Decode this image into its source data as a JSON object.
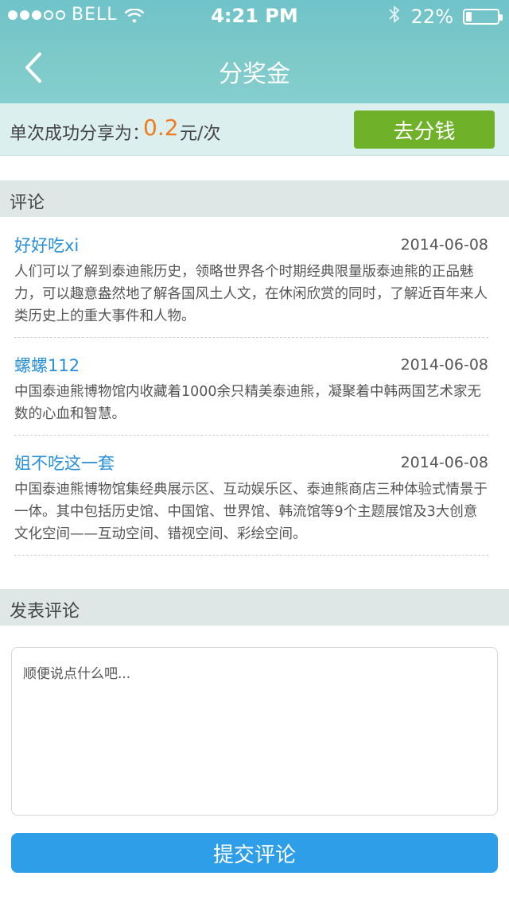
{
  "status_bar": {
    "carrier": "BELL",
    "time": "4:21 PM",
    "battery_text": "22%",
    "battery_level": 0.22,
    "signal_bars_filled": 3,
    "signal_bars_total": 5
  },
  "nav": {
    "title": "分奖金",
    "back_icon": "chevron-left-icon"
  },
  "share": {
    "label": "单次成功分享为：",
    "amount": "0.2",
    "unit": "元/次",
    "button": "去分钱",
    "button_color": "#6fb229",
    "amount_color": "#f07b1e"
  },
  "comments_section": {
    "title": "评论",
    "items": [
      {
        "user": "好好吃xi",
        "date": "2014-06-08",
        "text": "人们可以了解到泰迪熊历史，领略世界各个时期经典限量版泰迪熊的正品魅力，可以趣意盎然地了解各国风土人文，在休闲欣赏的同时，了解近百年来人类历史上的重大事件和人物。"
      },
      {
        "user": "螺螺112",
        "date": "2014-06-08",
        "text": "中国泰迪熊博物馆内收藏着1000余只精美泰迪熊，凝聚着中韩两国艺术家无数的心血和智慧。"
      },
      {
        "user": "姐不吃这一套",
        "date": "2014-06-08",
        "text": "中国泰迪熊博物馆集经典展示区、互动娱乐区、泰迪熊商店三种体验式情景于一体。其中包括历史馆、中国馆、世界馆、韩流馆等9个主题展馆及3大创意文化空间——互动空间、错视空间、彩绘空间。"
      }
    ]
  },
  "compose_section": {
    "title": "发表评论",
    "placeholder": "顺便说点什么吧...",
    "value": "",
    "submit": "提交评论",
    "submit_color": "#2e9ee9"
  }
}
